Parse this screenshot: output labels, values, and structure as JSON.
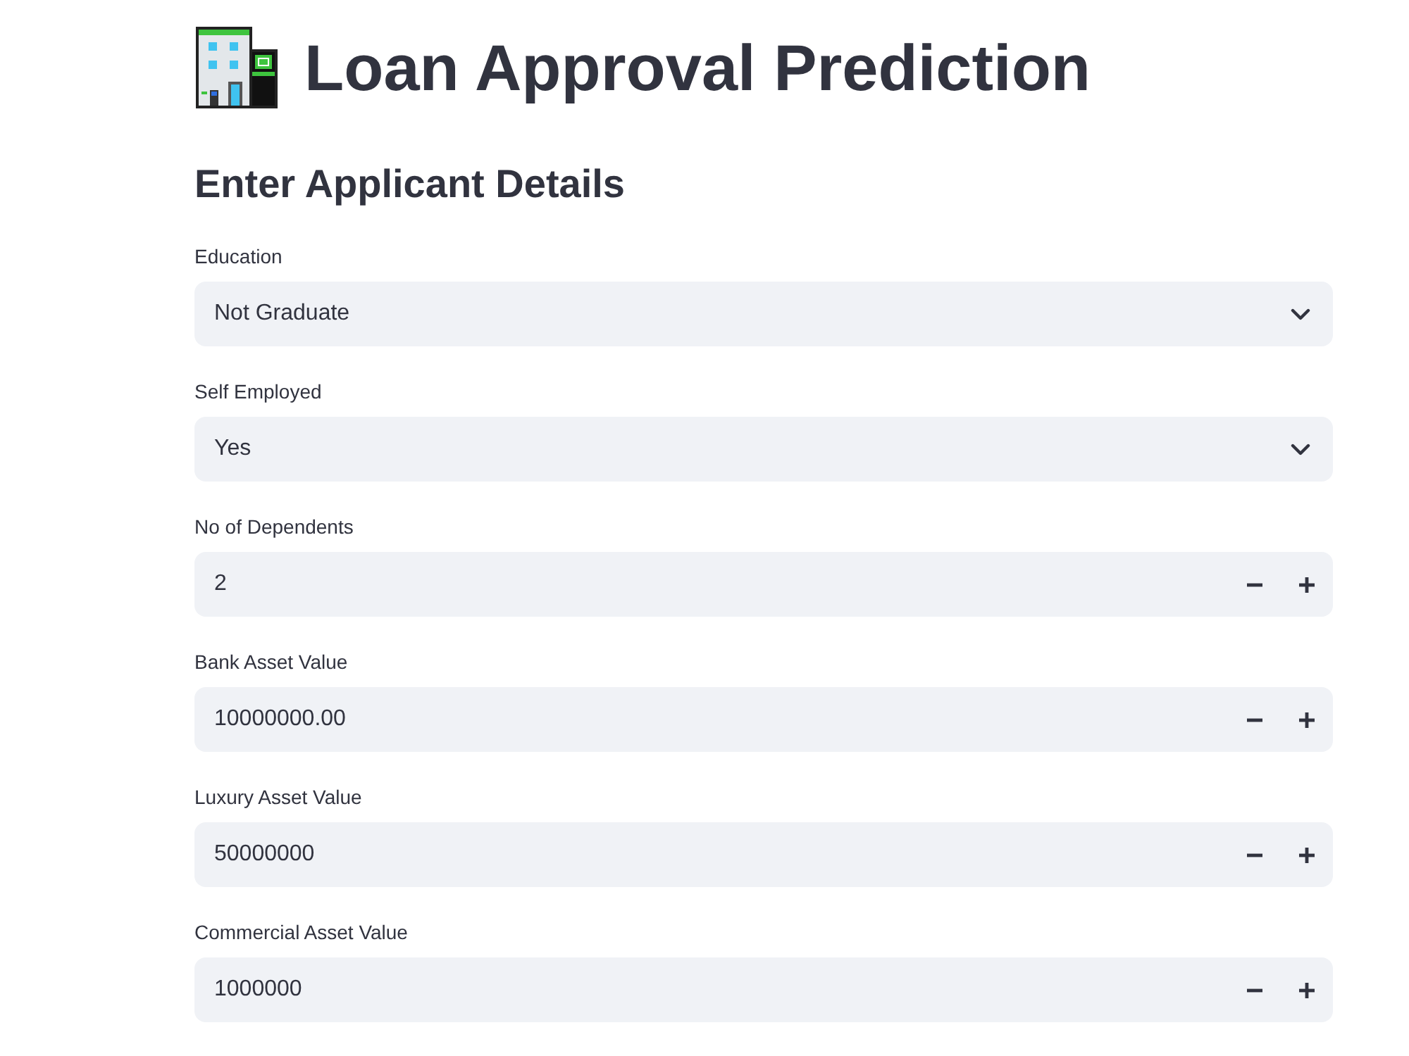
{
  "header": {
    "title": "Loan Approval Prediction"
  },
  "form": {
    "heading": "Enter Applicant Details",
    "fields": [
      {
        "kind": "select",
        "label": "Education",
        "value": "Not Graduate"
      },
      {
        "kind": "select",
        "label": "Self Employed",
        "value": "Yes"
      },
      {
        "kind": "number",
        "label": "No of Dependents",
        "value": "2"
      },
      {
        "kind": "number",
        "label": "Bank Asset Value",
        "value": "10000000.00"
      },
      {
        "kind": "number",
        "label": "Luxury Asset Value",
        "value": "50000000"
      },
      {
        "kind": "number",
        "label": "Commercial Asset Value",
        "value": "1000000"
      }
    ]
  }
}
